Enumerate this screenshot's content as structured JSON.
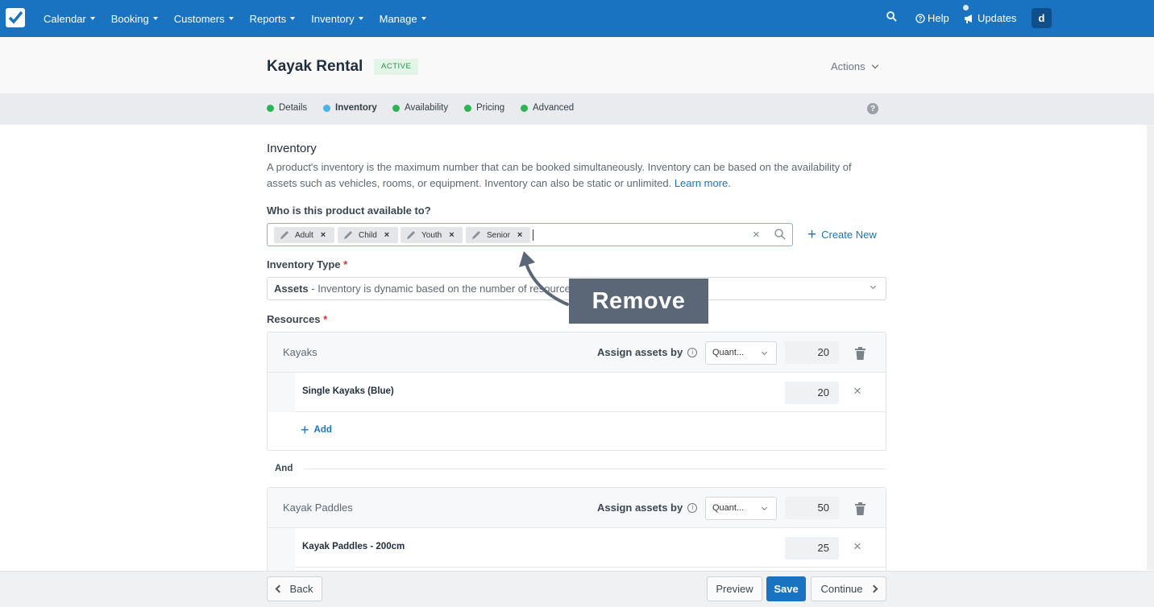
{
  "nav": {
    "items": [
      "Calendar",
      "Booking",
      "Customers",
      "Reports",
      "Inventory",
      "Manage"
    ],
    "help": "Help",
    "updates": "Updates",
    "avatar": "d"
  },
  "header": {
    "title": "Kayak Rental",
    "status": "ACTIVE",
    "actions": "Actions"
  },
  "steps": [
    {
      "label": "Details",
      "color": "#2db553"
    },
    {
      "label": "Inventory",
      "color": "#4ab3e6"
    },
    {
      "label": "Availability",
      "color": "#2db553"
    },
    {
      "label": "Pricing",
      "color": "#2db553"
    },
    {
      "label": "Advanced",
      "color": "#2db553"
    }
  ],
  "inventory": {
    "title": "Inventory",
    "description": "A product's inventory is the maximum number that can be booked simultaneously. Inventory can be based on the availability of assets such as vehicles, rooms, or equipment. Inventory can also be static or unlimited.",
    "learn_more": "Learn more",
    "available_to_label": "Who is this product available to?",
    "tags": [
      "Adult",
      "Child",
      "Youth",
      "Senior"
    ],
    "create_new": "Create New",
    "type_label": "Inventory Type",
    "type_value_bold": "Assets",
    "type_value_rest": " - Inventory is dynamic based on the number of resources available",
    "resources_label": "Resources"
  },
  "resources": [
    {
      "name": "Kayaks",
      "assign_label": "Assign assets by",
      "assign_value": "Quant...",
      "quantity": "20",
      "items": [
        {
          "name": "Single Kayaks (Blue)",
          "quantity": "20"
        }
      ],
      "add_label": "Add"
    },
    {
      "name": "Kayak Paddles",
      "assign_label": "Assign assets by",
      "assign_value": "Quant...",
      "quantity": "50",
      "items": [
        {
          "name": "Kayak Paddles - 200cm",
          "quantity": "25"
        }
      ]
    }
  ],
  "and_label": "And",
  "annotation": {
    "text": "Remove"
  },
  "footer": {
    "back": "Back",
    "preview": "Preview",
    "save": "Save",
    "continue": "Continue"
  }
}
